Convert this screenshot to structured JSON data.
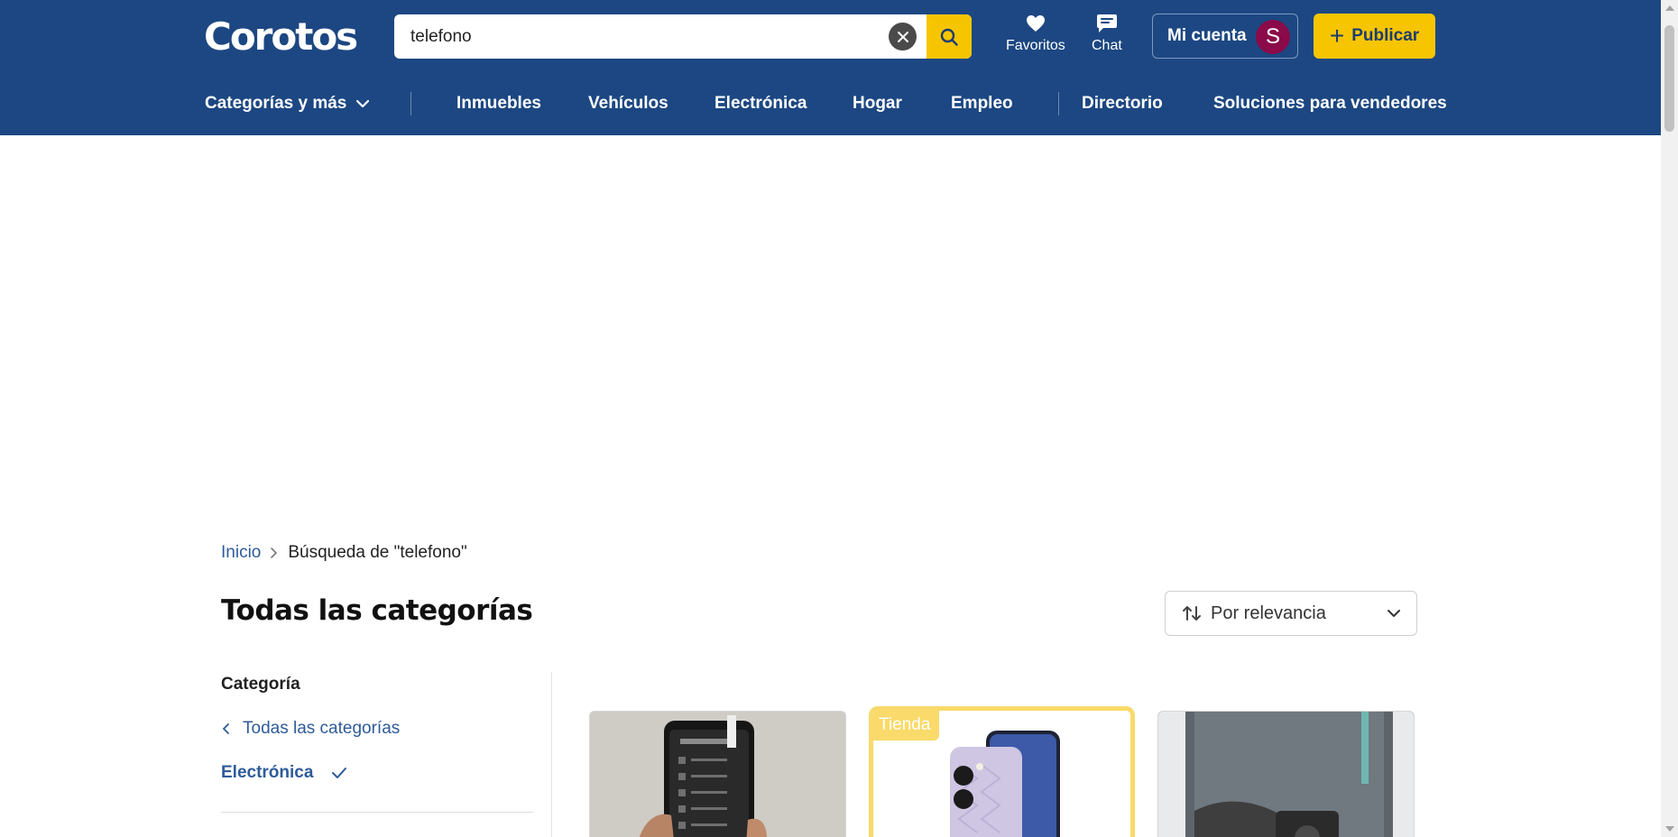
{
  "header": {
    "logo": "Corotos",
    "search": {
      "value": "telefono",
      "placeholder": ""
    },
    "favorites_label": "Favoritos",
    "chat_label": "Chat",
    "account_label": "Mi cuenta",
    "avatar_initial": "S",
    "publish_label": "Publicar"
  },
  "nav": {
    "categories_label": "Categorías y más",
    "items": [
      "Inmuebles",
      "Vehículos",
      "Electrónica",
      "Hogar",
      "Empleo",
      "Directorio",
      "Soluciones para vendedores"
    ]
  },
  "breadcrumb": {
    "home": "Inicio",
    "current": "Búsqueda de \"telefono\""
  },
  "page_title": "Todas las categorías",
  "sort": {
    "selected": "Por relevancia"
  },
  "sidebar": {
    "heading": "Categoría",
    "all_categories": "Todas las categorías",
    "selected_category": "Electrónica"
  },
  "listings": {
    "store_badge": "Tienda"
  },
  "colors": {
    "header_bg": "#1c4782",
    "accent_yellow": "#f7c500",
    "link_blue": "#2e5b9a",
    "avatar_bg": "#8a0a4a",
    "store_badge": "#f9da6a"
  }
}
